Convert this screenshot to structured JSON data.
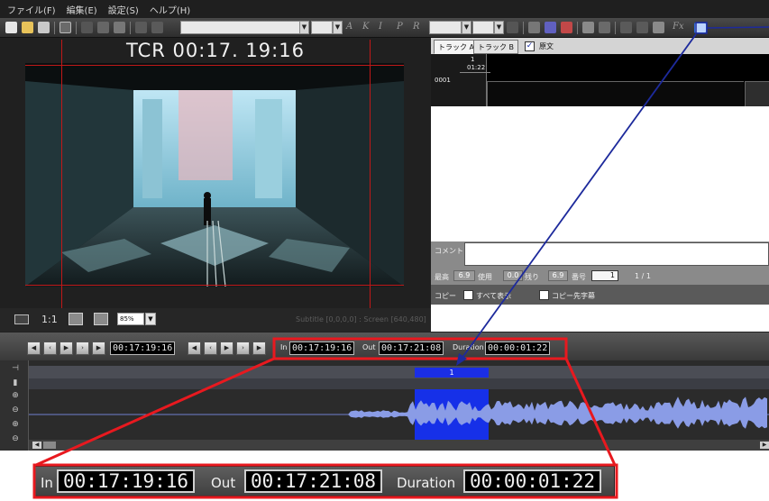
{
  "menu": {
    "items": [
      "ファイル(F)",
      "編集(E)",
      "設定(S)",
      "ヘルプ(H)"
    ]
  },
  "toolbar": {
    "font_size_value": "",
    "bold_label": "A",
    "italic_label": "K",
    "italic2_label": "I",
    "p_label": "P",
    "r_label": "R",
    "fx_label": "Fx"
  },
  "video": {
    "tcr_timecode": "TCR  00:17. 19:16",
    "one_to_one_label": "1:1",
    "zoom_value": "85%",
    "subtitle_info": "Subtitle [0,0,0,0] : Screen [640,480]"
  },
  "right_panel": {
    "tab_a": "トラック A",
    "tab_b": "トラック B",
    "original_label": "原文",
    "ruler_index": "1",
    "ruler_time": "01:22",
    "row_number": "0001",
    "comment_label": "コメント",
    "max_label": "最高",
    "max_value": "6.9",
    "use_label": "使用",
    "use_value": "0.0",
    "remain_label": "残り",
    "remain_value": "6.9",
    "number_label": "番号",
    "number_value": "1",
    "page_count": "1 / 1",
    "copy_label": "コピー",
    "show_all_label": "すべて表示",
    "copy_dest_label": "コピー先字幕"
  },
  "transport": {
    "current_tc": "00:17:19:16",
    "in_label": "In",
    "in_tc": "00:17:19:16",
    "out_label": "Out",
    "out_tc": "00:17:21:08",
    "duration_label": "Duration",
    "duration_tc": "00:00:01:22"
  },
  "timeline": {
    "subtitle_block_index": "1"
  },
  "zoom_callout": {
    "in_label": "In",
    "in_tc": "00:17:19:16",
    "out_label": "Out",
    "out_tc": "00:17:21:08",
    "duration_label": "Duration",
    "duration_tc": "00:00:01:22"
  },
  "colors": {
    "callout_red": "#e8191f",
    "arrow_blue": "#1d2a9c",
    "selection_blue": "#1630e8",
    "waveform": "#8a9ce6",
    "guide_red": "#c01818"
  }
}
